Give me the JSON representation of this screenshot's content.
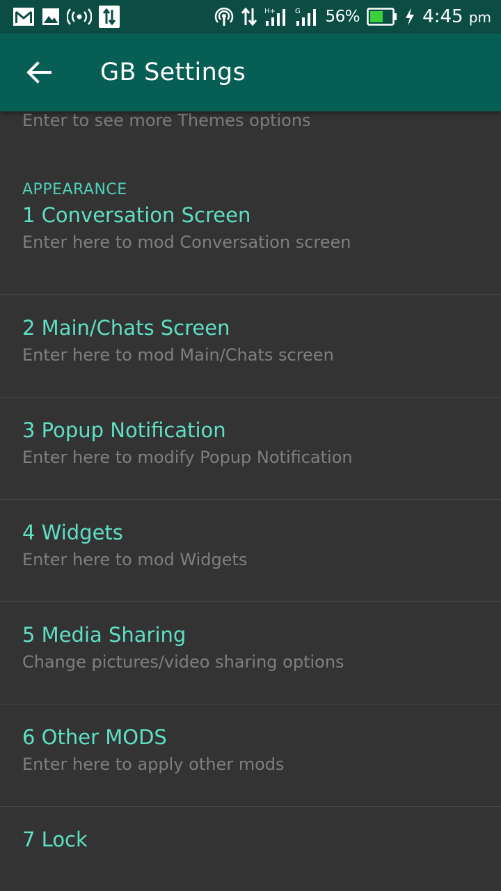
{
  "status_bar": {
    "battery_percent": "56%",
    "battery_level": 0.56,
    "time": "4:45",
    "meridiem": "pm",
    "left_icons": [
      "gmail-icon",
      "gallery-icon",
      "hotspot-icon",
      "data-transfer-icon"
    ],
    "right_icons": [
      "wifi-tethering-icon",
      "data-arrows-icon",
      "signal-h-plus-icon",
      "signal-g-icon",
      "battery-icon",
      "charging-icon"
    ]
  },
  "app_bar": {
    "title": "GB Settings",
    "back_icon": "arrow-back-icon"
  },
  "partial_item": {
    "summary": "Enter to see more Themes options"
  },
  "category": {
    "label": "APPEARANCE"
  },
  "items": [
    {
      "title": "1 Conversation Screen",
      "summary": "Enter here to mod Conversation screen"
    },
    {
      "title": "2 Main/Chats Screen",
      "summary": "Enter here to mod Main/Chats screen"
    },
    {
      "title": "3 Popup Notification",
      "summary": "Enter here to modify Popup Notification"
    },
    {
      "title": "4 Widgets",
      "summary": "Enter here to mod Widgets"
    },
    {
      "title": "5 Media Sharing",
      "summary": "Change pictures/video sharing options"
    },
    {
      "title": "6 Other MODS",
      "summary": "Enter here to apply other mods"
    },
    {
      "title": "7 Lock",
      "summary": ""
    }
  ],
  "colors": {
    "status_bar": "#0b4d44",
    "app_bar": "#075e54",
    "background": "#333333",
    "accent": "#5fe0c5",
    "summary_text": "#7f7f7f"
  }
}
